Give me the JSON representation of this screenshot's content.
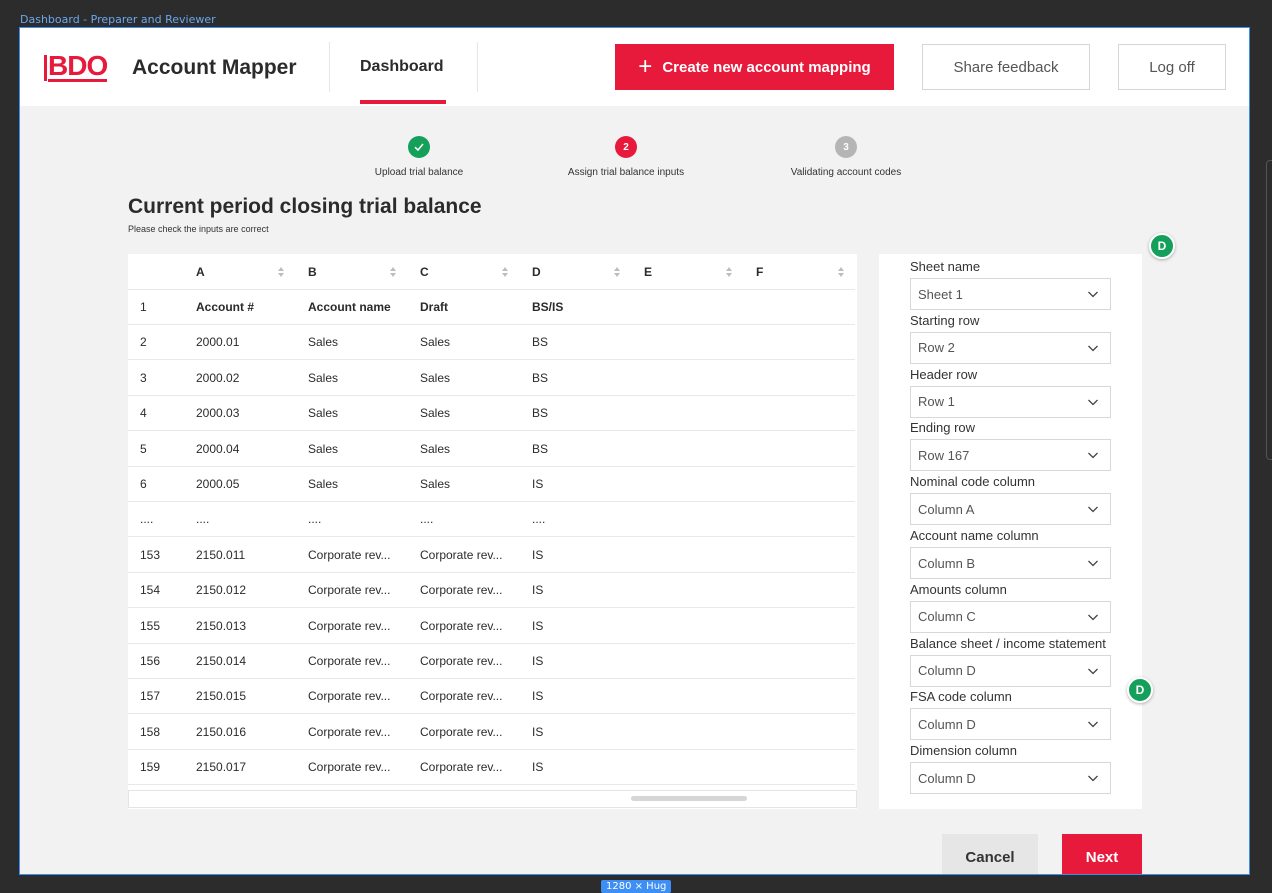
{
  "frame": {
    "label": "Dashboard - Preparer and Reviewer",
    "size_chip": "1280 × Hug"
  },
  "header": {
    "logo": "BDO",
    "app_title": "Account Mapper",
    "nav_tab": "Dashboard",
    "create_label": "Create new account mapping",
    "feedback_label": "Share feedback",
    "logoff_label": "Log off"
  },
  "steps": [
    {
      "number": "",
      "label": "Upload trial balance",
      "state": "complete",
      "color": "#14a05a"
    },
    {
      "number": "2",
      "label": "Assign trial balance inputs",
      "state": "active",
      "color": "#e81a3b"
    },
    {
      "number": "3",
      "label": "Validating account codes",
      "state": "pending",
      "color": "#b5b5b5"
    }
  ],
  "section": {
    "title": "Current period closing trial balance",
    "subtitle": "Please check the inputs are correct"
  },
  "table": {
    "columns": [
      "",
      "A",
      "B",
      "C",
      "D",
      "E",
      "F"
    ],
    "rows": [
      [
        "1",
        "Account #",
        "Account name",
        "Draft",
        "BS/IS"
      ],
      [
        "2",
        "2000.01",
        "Sales",
        "Sales",
        "BS"
      ],
      [
        "3",
        "2000.02",
        "Sales",
        "Sales",
        "BS"
      ],
      [
        "4",
        "2000.03",
        "Sales",
        "Sales",
        "BS"
      ],
      [
        "5",
        "2000.04",
        "Sales",
        "Sales",
        "BS"
      ],
      [
        "6",
        "2000.05",
        "Sales",
        "Sales",
        "IS"
      ],
      [
        "....",
        "....",
        "....",
        "....",
        "...."
      ],
      [
        "153",
        "2150.011",
        "Corporate rev...",
        "Corporate rev...",
        "IS"
      ],
      [
        "154",
        "2150.012",
        "Corporate rev...",
        "Corporate rev...",
        "IS"
      ],
      [
        "155",
        "2150.013",
        "Corporate rev...",
        "Corporate rev...",
        "IS"
      ],
      [
        "156",
        "2150.014",
        "Corporate rev...",
        "Corporate rev...",
        "IS"
      ],
      [
        "157",
        "2150.015",
        "Corporate rev...",
        "Corporate rev...",
        "IS"
      ],
      [
        "158",
        "2150.016",
        "Corporate rev...",
        "Corporate rev...",
        "IS"
      ],
      [
        "159",
        "2150.017",
        "Corporate rev...",
        "Corporate rev...",
        "IS"
      ]
    ]
  },
  "settings": [
    {
      "label": "Sheet name",
      "value": "Sheet 1"
    },
    {
      "label": "Starting row",
      "value": "Row 2"
    },
    {
      "label": "Header row",
      "value": "Row 1"
    },
    {
      "label": "Ending row",
      "value": "Row 167"
    },
    {
      "label": "Nominal code column",
      "value": "Column A"
    },
    {
      "label": "Account name column",
      "value": "Column B"
    },
    {
      "label": "Amounts column",
      "value": "Column C"
    },
    {
      "label": "Balance sheet / income statement",
      "value": "Column D"
    },
    {
      "label": "FSA code column",
      "value": "Column D"
    },
    {
      "label": "Dimension column",
      "value": "Column D"
    }
  ],
  "avatars": [
    "D",
    "D"
  ],
  "footer": {
    "cancel_label": "Cancel",
    "next_label": "Next"
  },
  "colors": {
    "brand_red": "#e81a3b",
    "success_green": "#14a05a",
    "pending_grey": "#b5b5b5"
  }
}
